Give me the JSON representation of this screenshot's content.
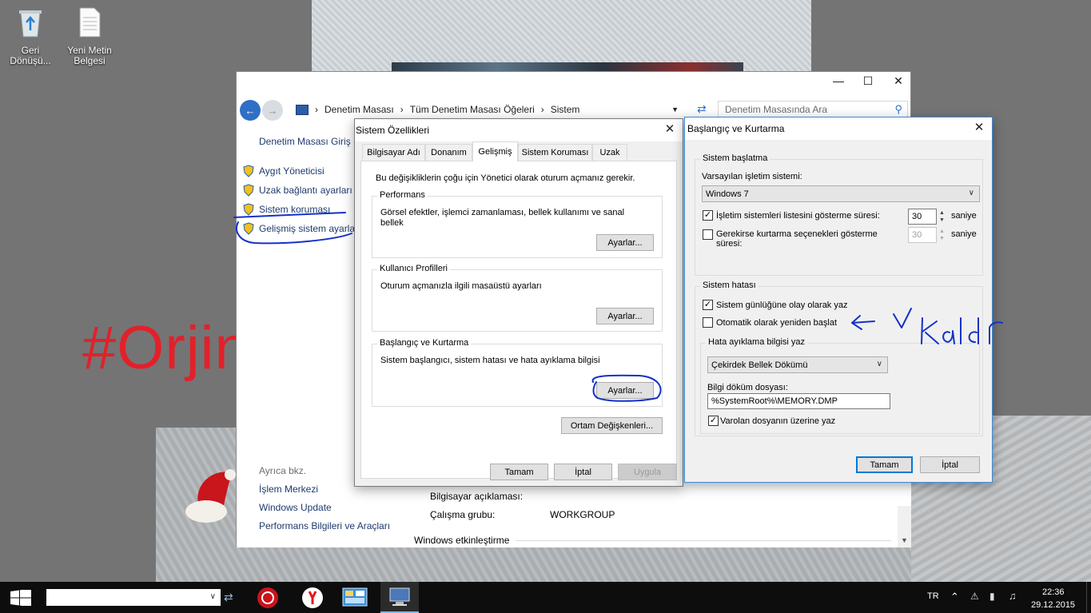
{
  "desktop": {
    "icons": [
      {
        "label_line1": "Geri",
        "label_line2": "Dönüşü..."
      },
      {
        "label_line1": "Yeni Metin",
        "label_line2": "Belgesi"
      }
    ],
    "annotation_text": "#Orjinal"
  },
  "control_panel": {
    "breadcrumb": [
      "Denetim Masası",
      "Tüm Denetim Masası Öğeleri",
      "Sistem"
    ],
    "search_placeholder": "Denetim Masasında Ara",
    "left_home": "Denetim Masası Giriş",
    "left_links": [
      "Aygıt Yöneticisi",
      "Uzak bağlantı ayarları",
      "Sistem koruması",
      "Gelişmiş sistem ayarları"
    ],
    "see_also_header": "Ayrıca bkz.",
    "see_also": [
      "İşlem Merkezi",
      "Windows Update",
      "Performans Bilgileri ve Araçları"
    ],
    "computer_description_label": "Bilgisayar açıklaması:",
    "workgroup_label": "Çalışma grubu:",
    "workgroup_value": "WORKGROUP",
    "activation_header": "Windows etkinleştirme"
  },
  "system_properties": {
    "title": "Sistem Özellikleri",
    "tabs": [
      "Bilgisayar Adı",
      "Donanım",
      "Gelişmiş",
      "Sistem Koruması",
      "Uzak"
    ],
    "active_tab": "Gelişmiş",
    "admin_note": "Bu değişikliklerin çoğu için Yönetici olarak oturum açmanız gerekir.",
    "performance": {
      "label": "Performans",
      "desc_line1": "Görsel efektler, işlemci zamanlaması, bellek kullanımı ve sanal",
      "desc_line2": "bellek",
      "button": "Ayarlar..."
    },
    "user_profiles": {
      "label": "Kullanıcı Profilleri",
      "desc": "Oturum açmanızla ilgili masaüstü ayarları",
      "button": "Ayarlar..."
    },
    "startup_recovery": {
      "label": "Başlangıç ve Kurtarma",
      "desc": "Sistem başlangıcı, sistem hatası ve hata ayıklama bilgisi",
      "button": "Ayarlar..."
    },
    "env_button": "Ortam Değişkenleri...",
    "ok": "Tamam",
    "cancel": "İptal",
    "apply": "Uygula"
  },
  "startup_recovery_dialog": {
    "title": "Başlangıç ve Kurtarma",
    "system_startup": {
      "label": "Sistem başlatma",
      "default_os_label": "Varsayılan işletim sistemi:",
      "default_os": "Windows 7",
      "show_list_label": "İşletim sistemleri listesini gösterme süresi:",
      "show_list_checked": true,
      "show_list_value": "30",
      "show_recovery_line1": "Gerekirse kurtarma seçenekleri gösterme",
      "show_recovery_line2": "süresi:",
      "show_recovery_checked": false,
      "show_recovery_value": "30",
      "unit": "saniye"
    },
    "system_failure": {
      "label": "Sistem hatası",
      "write_event_label": "Sistem günlüğüne olay olarak yaz",
      "write_event_checked": true,
      "auto_restart_label": "Otomatik olarak yeniden başlat",
      "auto_restart_checked": false,
      "debug_group_label": "Hata ayıklama bilgisi yaz",
      "debug_type": "Çekirdek Bellek Dökümü",
      "dump_file_label": "Bilgi döküm dosyası:",
      "dump_file": "%SystemRoot%\\MEMORY.DMP",
      "overwrite_label": "Varolan dosyanın üzerine yaz",
      "overwrite_checked": true
    },
    "ok": "Tamam",
    "cancel": "İptal"
  },
  "taskbar": {
    "language": "TR",
    "time": "22:36",
    "date": "29.12.2015"
  },
  "colors": {
    "annotation_red": "#e3202a",
    "ink_blue": "#1531c8",
    "link_blue": "#1e3a6e",
    "focus_blue": "#0078d7"
  }
}
